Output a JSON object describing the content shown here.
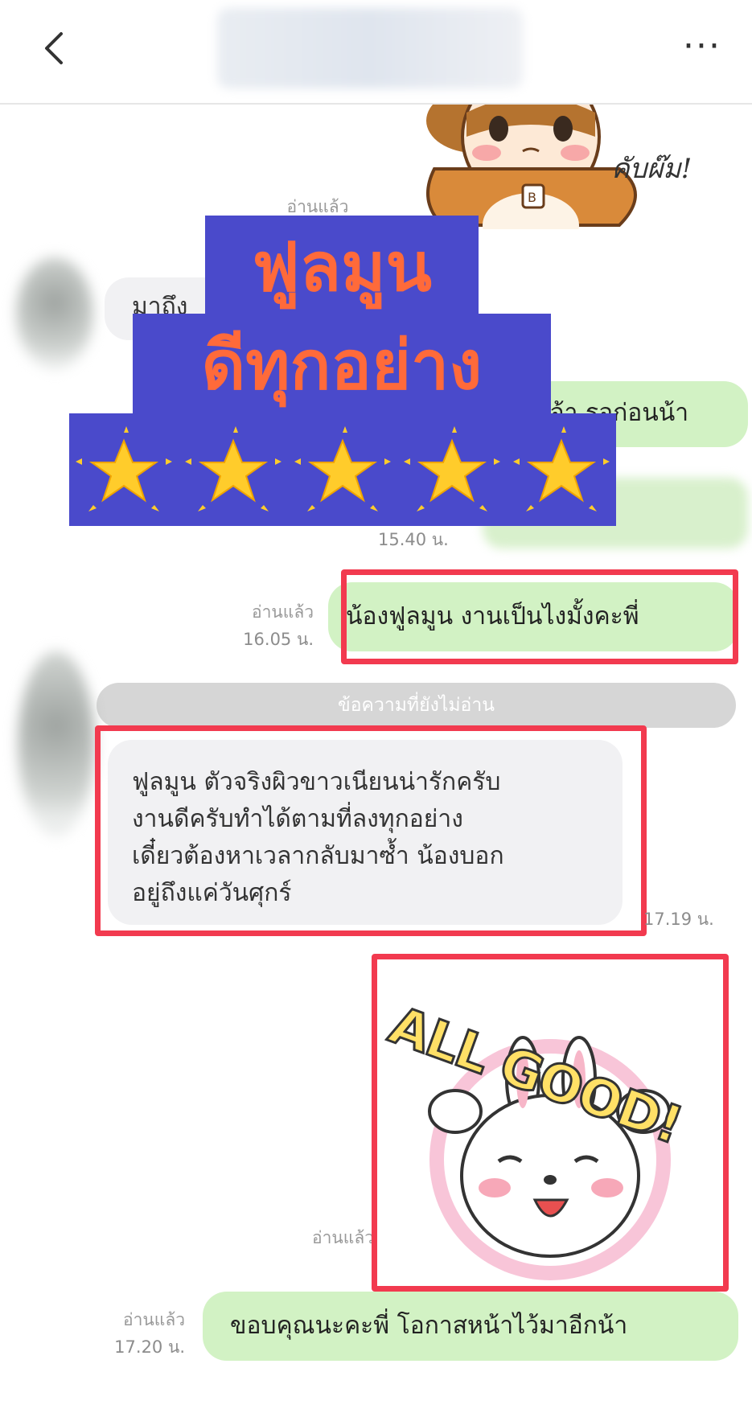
{
  "header": {
    "back_icon": "chevron-left-icon",
    "more_icon": "more-dots-icon",
    "more_label": "···"
  },
  "top_sticker": {
    "caption": "คับผ๊ม!"
  },
  "promo": {
    "line1": "ฟูลมูน",
    "line2": "ดีทุกอย่าง",
    "stars_count": 5,
    "star_icon": "sparkle-star-icon",
    "text_color": "#ff6a3a",
    "bg_color": "#4a4acb"
  },
  "messages": {
    "read_1": "อ่านแล้ว",
    "incoming_partial": "มาถึง",
    "outgoing_partial": "จ้า รอก่อนน้า",
    "time_1540": "15.40 น.",
    "m1_read": "อ่านแล้ว",
    "m1_time": "16.05 น.",
    "m1_text": "น้องฟูลมูน งานเป็นไงมั้งคะพี่",
    "unread_divider": "ข้อความที่ยังไม่อ่าน",
    "m2_lines": [
      "ฟูลมูน  ตัวจริงผิวขาวเนียนน่ารักครับ",
      "งานดีครับทำได้ตามที่ลงทุกอย่าง",
      "เดี๋ยวต้องหาเวลากลับมาซ้ำ น้องบอก",
      "อยู่ถึงแค่วันศุกร์"
    ],
    "m2_time": "17.19 น.",
    "sticker_read": "อ่านแล้ว",
    "sticker_word": "ALL GOOD!",
    "m3_read": "อ่านแล้ว",
    "m3_time": "17.20 น.",
    "m3_text": "ขอบคุณนะคะพี่ โอกาสหน้าไว้มาอีกน้า"
  },
  "colors": {
    "green_bubble": "#d2f2c4",
    "grey_bubble": "#f1f1f3",
    "highlight_red": "#f23a4f",
    "divider": "#d6d6d6"
  }
}
